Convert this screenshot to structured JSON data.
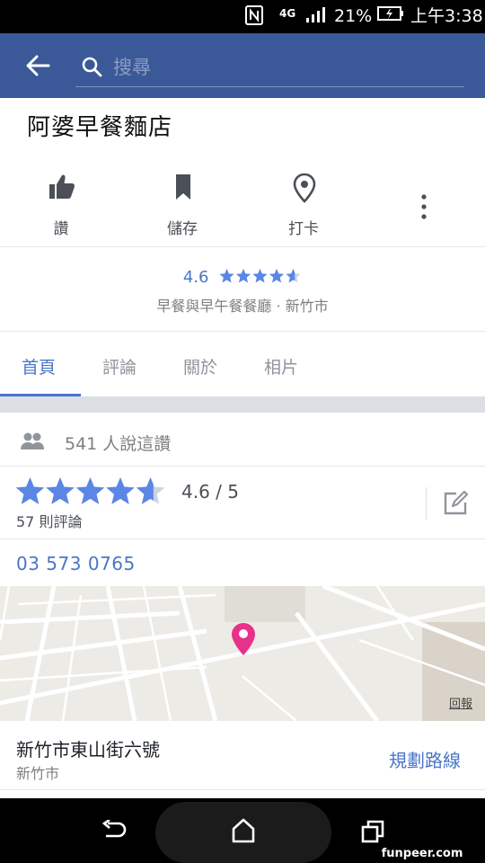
{
  "status_bar": {
    "network": "4G",
    "battery": "21%",
    "time": "上午3:38"
  },
  "app_bar": {
    "search_placeholder": "搜尋"
  },
  "page": {
    "title": "阿婆早餐麵店"
  },
  "actions": {
    "like": "讚",
    "save": "儲存",
    "checkin": "打卡"
  },
  "summary": {
    "rating": "4.6",
    "rating_fraction": 0.92,
    "category": "早餐與早午餐餐廳 · 新竹市"
  },
  "tabs": [
    "首頁",
    "評論",
    "關於",
    "相片"
  ],
  "active_tab": 0,
  "likes": {
    "text": "541 人說這讚"
  },
  "rating": {
    "score_text": "4.6 / 5",
    "reviews_text": "57 則評論",
    "stars": 4.6
  },
  "contact": {
    "phone": "03 573 0765"
  },
  "map": {
    "report_label": "回報",
    "marker_color": "#e8318a"
  },
  "address": {
    "street": "新竹市東山街六號",
    "city": "新竹市",
    "directions": "規劃路線"
  },
  "watermark": "funpeer.com",
  "colors": {
    "brand": "#3b5998",
    "accent": "#4a76c9",
    "star": "#5b86e5"
  }
}
